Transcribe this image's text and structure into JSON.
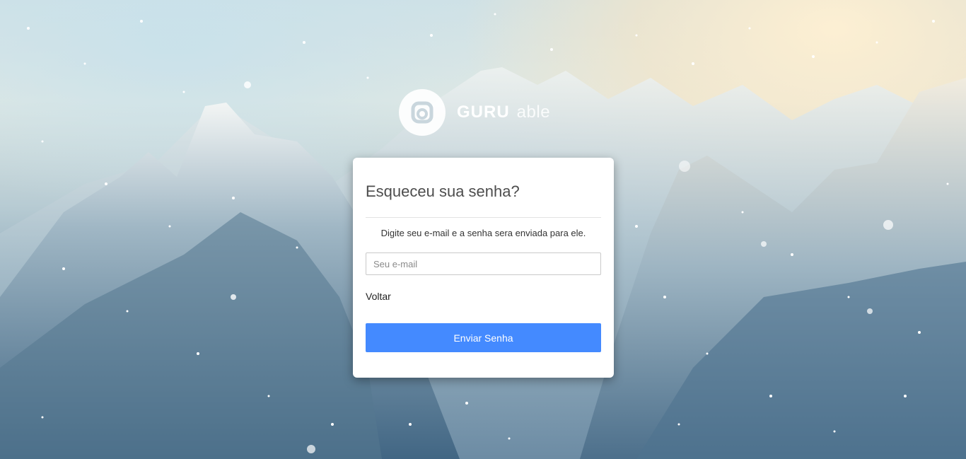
{
  "brand": {
    "logo_icon": "guru-logo-icon",
    "name_bold": "GURU",
    "name_light": "able"
  },
  "form": {
    "title": "Esqueceu sua senha?",
    "description": "Digite seu e-mail e a senha sera enviada para ele.",
    "email_placeholder": "Seu e-mail",
    "email_value": "",
    "back_link": "Voltar",
    "submit_label": "Enviar Senha"
  },
  "colors": {
    "accent": "#448aff",
    "card_background": "#ffffff",
    "title_text": "#4d4d4d"
  }
}
